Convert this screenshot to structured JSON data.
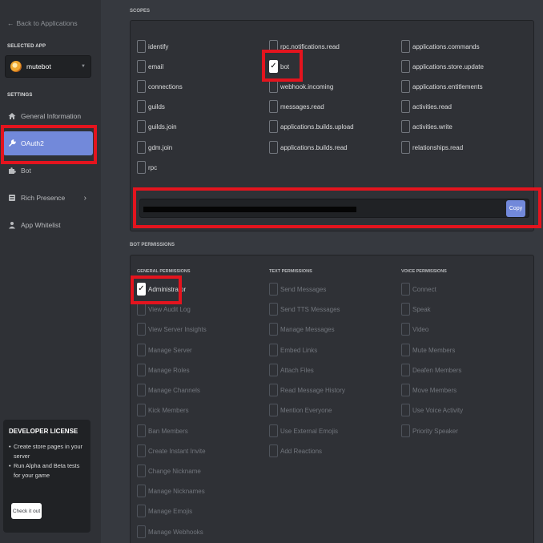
{
  "sidebar": {
    "back_label": "Back to Applications",
    "selected_app_heading": "SELECTED APP",
    "app_name": "mutebot",
    "settings_heading": "SETTINGS",
    "nav": [
      "General Information",
      "OAuth2",
      "Bot",
      "Rich Presence",
      "App Whitelist"
    ],
    "developer_license": {
      "title": "DEVELOPER LICENSE",
      "bullets": [
        "Create store pages in your server",
        "Run Alpha and Beta tests for your game"
      ],
      "button": "Check it out"
    }
  },
  "scopes": {
    "heading": "SCOPES",
    "items": [
      {
        "label": "identify",
        "checked": false
      },
      {
        "label": "email",
        "checked": false
      },
      {
        "label": "connections",
        "checked": false
      },
      {
        "label": "guilds",
        "checked": false
      },
      {
        "label": "guilds.join",
        "checked": false
      },
      {
        "label": "gdm.join",
        "checked": false
      },
      {
        "label": "rpc",
        "checked": false
      },
      {
        "label": "rpc.notifications.read",
        "checked": false
      },
      {
        "label": "bot",
        "checked": true
      },
      {
        "label": "webhook.incoming",
        "checked": false
      },
      {
        "label": "messages.read",
        "checked": false
      },
      {
        "label": "applications.builds.upload",
        "checked": false
      },
      {
        "label": "applications.builds.read",
        "checked": false
      },
      {
        "label": "applications.commands",
        "checked": false
      },
      {
        "label": "applications.store.update",
        "checked": false
      },
      {
        "label": "applications.entitlements",
        "checked": false
      },
      {
        "label": "activities.read",
        "checked": false
      },
      {
        "label": "activities.write",
        "checked": false
      },
      {
        "label": "relationships.read",
        "checked": false
      }
    ],
    "copy_label": "Copy"
  },
  "bot_permissions": {
    "heading": "BOT PERMISSIONS",
    "general": {
      "heading": "GENERAL PERMISSIONS",
      "items": [
        {
          "label": "Administrator",
          "checked": true
        },
        {
          "label": "View Audit Log",
          "checked": false
        },
        {
          "label": "View Server Insights",
          "checked": false
        },
        {
          "label": "Manage Server",
          "checked": false
        },
        {
          "label": "Manage Roles",
          "checked": false
        },
        {
          "label": "Manage Channels",
          "checked": false
        },
        {
          "label": "Kick Members",
          "checked": false
        },
        {
          "label": "Ban Members",
          "checked": false
        },
        {
          "label": "Create Instant Invite",
          "checked": false
        },
        {
          "label": "Change Nickname",
          "checked": false
        },
        {
          "label": "Manage Nicknames",
          "checked": false
        },
        {
          "label": "Manage Emojis",
          "checked": false
        },
        {
          "label": "Manage Webhooks",
          "checked": false
        }
      ]
    },
    "text": {
      "heading": "TEXT PERMISSIONS",
      "items": [
        {
          "label": "Send Messages",
          "checked": false
        },
        {
          "label": "Send TTS Messages",
          "checked": false
        },
        {
          "label": "Manage Messages",
          "checked": false
        },
        {
          "label": "Embed Links",
          "checked": false
        },
        {
          "label": "Attach Files",
          "checked": false
        },
        {
          "label": "Read Message History",
          "checked": false
        },
        {
          "label": "Mention Everyone",
          "checked": false
        },
        {
          "label": "Use External Emojis",
          "checked": false
        },
        {
          "label": "Add Reactions",
          "checked": false
        }
      ]
    },
    "voice": {
      "heading": "VOICE PERMISSIONS",
      "items": [
        {
          "label": "Connect",
          "checked": false
        },
        {
          "label": "Speak",
          "checked": false
        },
        {
          "label": "Video",
          "checked": false
        },
        {
          "label": "Mute Members",
          "checked": false
        },
        {
          "label": "Deafen Members",
          "checked": false
        },
        {
          "label": "Move Members",
          "checked": false
        },
        {
          "label": "Use Voice Activity",
          "checked": false
        },
        {
          "label": "Priority Speaker",
          "checked": false
        }
      ]
    }
  },
  "colors": {
    "accent": "#7289da",
    "highlight": "#e4141e",
    "background": "#36393f",
    "sidebar": "#2f3136"
  }
}
